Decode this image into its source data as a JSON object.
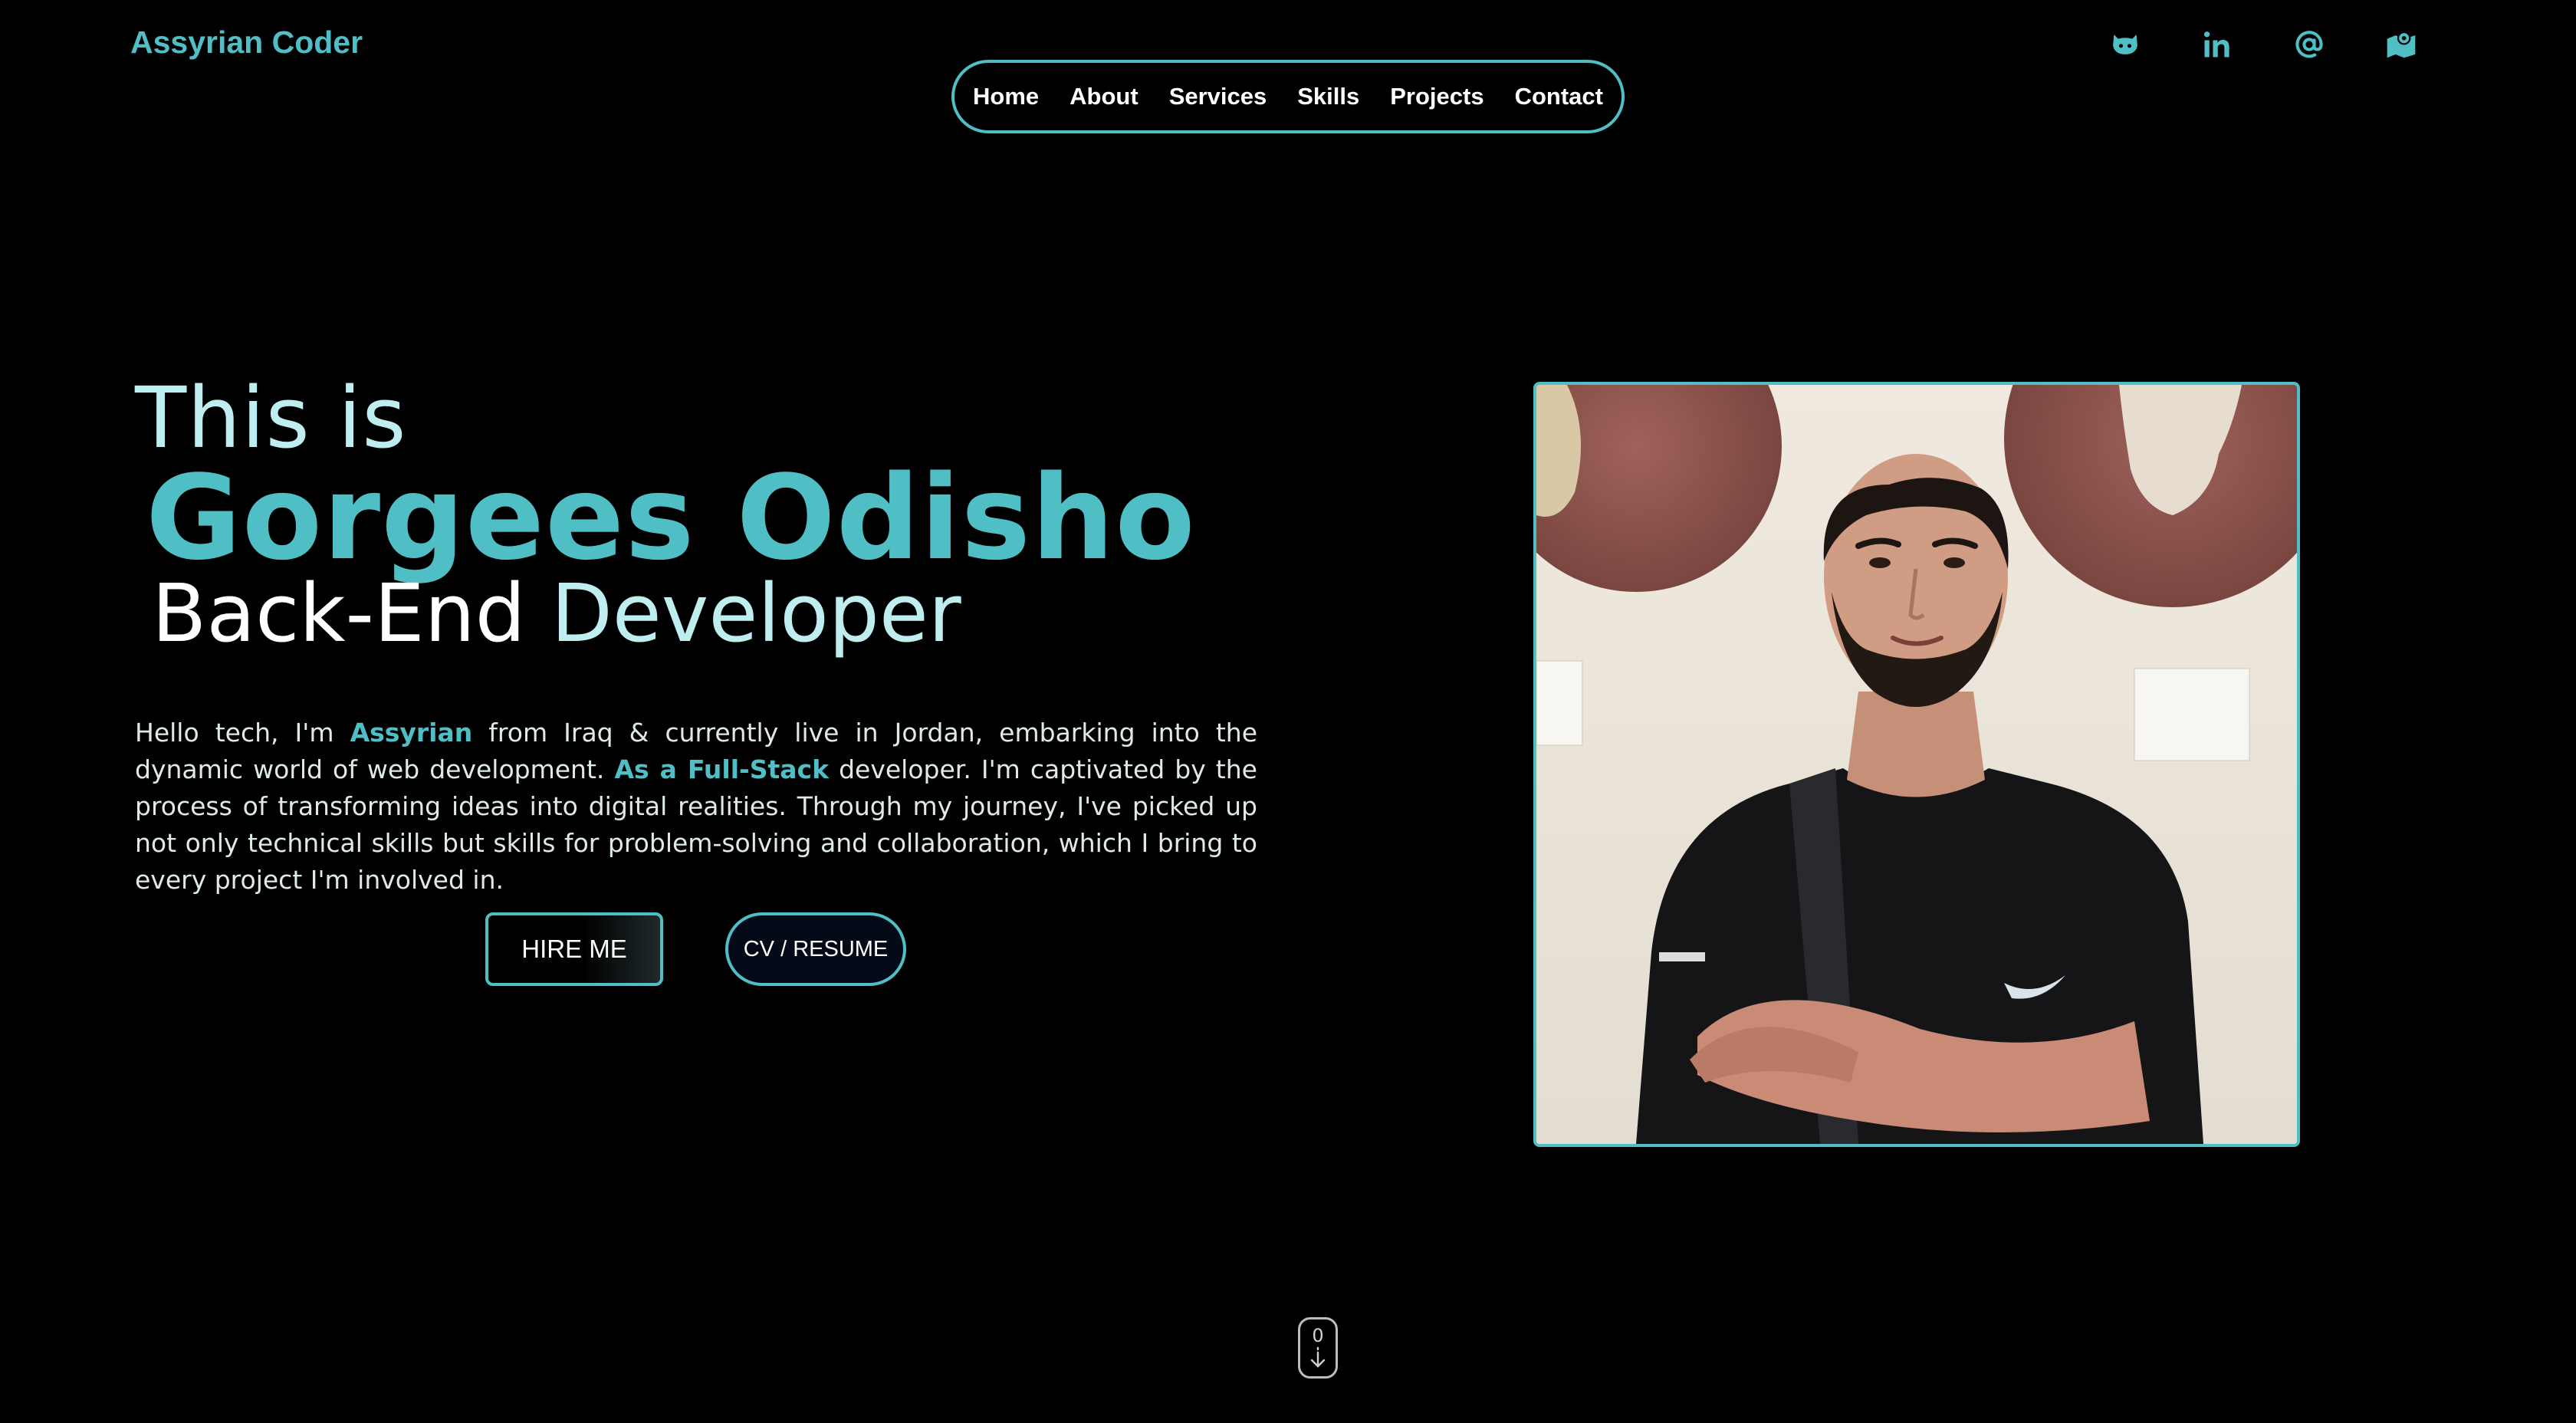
{
  "brand": {
    "name": "Assyrian Coder"
  },
  "nav": {
    "items": [
      "Home",
      "About",
      "Services",
      "Skills",
      "Projects",
      "Contact"
    ]
  },
  "social": {
    "icons": [
      "github-icon",
      "linkedin-icon",
      "email-at-icon",
      "map-location-icon"
    ]
  },
  "hero": {
    "intro": "This is",
    "name": "Gorgees Odisho",
    "role_part1": "Back-End",
    "role_part2": "Developer"
  },
  "bio": {
    "t1": "Hello tech, I'm ",
    "h1": "Assyrian",
    "t2": " from Iraq & currently live in Jordan, embarking into the dynamic world of web development. ",
    "h2": "As a Full-Stack",
    "t3": " developer. I'm captivated by the process of transforming ideas into digital realities. Through my journey, I've picked up not only technical skills but skills for problem-solving and collaboration, which I bring to every project I'm involved in."
  },
  "buttons": {
    "hire": "HIRE ME",
    "cv": "CV / RESUME"
  },
  "scroll_indicator": {
    "count": "0"
  },
  "colors": {
    "accent": "#4fbfc5",
    "accent_light": "#bfeef0",
    "background": "#000000"
  }
}
